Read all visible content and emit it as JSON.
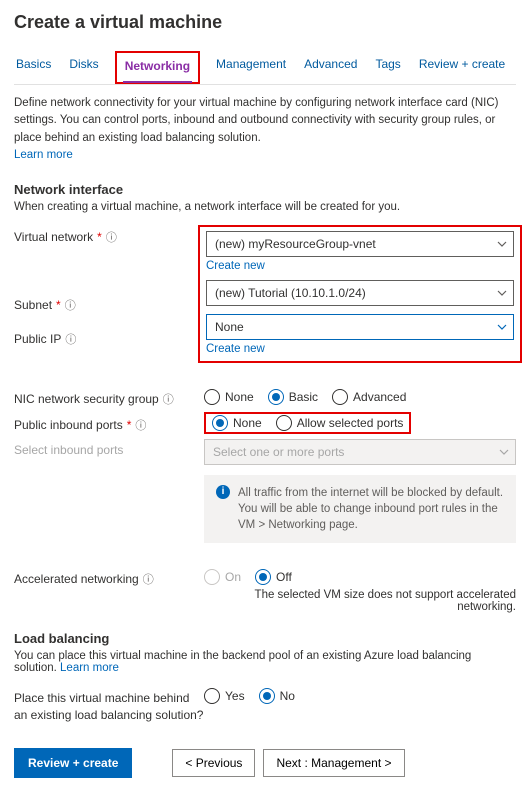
{
  "title": "Create a virtual machine",
  "tabs": {
    "basics": "Basics",
    "disks": "Disks",
    "networking": "Networking",
    "management": "Management",
    "advanced": "Advanced",
    "tags": "Tags",
    "review": "Review + create"
  },
  "intro": {
    "text": "Define network connectivity for your virtual machine by configuring network interface card (NIC) settings. You can control ports, inbound and outbound connectivity with security group rules, or place behind an existing load balancing solution.",
    "learn_more": "Learn more"
  },
  "sections": {
    "nic_heading": "Network interface",
    "nic_sub": "When creating a virtual machine, a network interface will be created for you.",
    "lb_heading": "Load balancing",
    "lb_sub_prefix": "You can place this virtual machine in the backend pool of an existing Azure load balancing solution. ",
    "lb_learn": "Learn more"
  },
  "fields": {
    "vnet": {
      "label": "Virtual network",
      "value": "(new) myResourceGroup-vnet",
      "create": "Create new"
    },
    "subnet": {
      "label": "Subnet",
      "value": "(new) Tutorial (10.10.1.0/24)"
    },
    "public_ip": {
      "label": "Public IP",
      "value": "None",
      "create": "Create new"
    },
    "nsg": {
      "label": "NIC network security group",
      "none": "None",
      "basic": "Basic",
      "advanced": "Advanced"
    },
    "inbound": {
      "label": "Public inbound ports",
      "none": "None",
      "allow": "Allow selected ports"
    },
    "select_ports": {
      "label": "Select inbound ports",
      "placeholder": "Select one or more ports"
    },
    "info_box": "All traffic from the internet will be blocked by default. You will be able to change inbound port rules in the VM > Networking page.",
    "accel": {
      "label": "Accelerated networking",
      "on": "On",
      "off": "Off",
      "note": "The selected VM size does not support accelerated networking."
    },
    "lb_q": {
      "label": "Place this virtual machine behind an existing load balancing solution?",
      "yes": "Yes",
      "no": "No"
    }
  },
  "footer": {
    "review": "Review + create",
    "prev": "< Previous",
    "next": "Next : Management >"
  },
  "icons": {
    "info_glyph": "ⓘ"
  }
}
